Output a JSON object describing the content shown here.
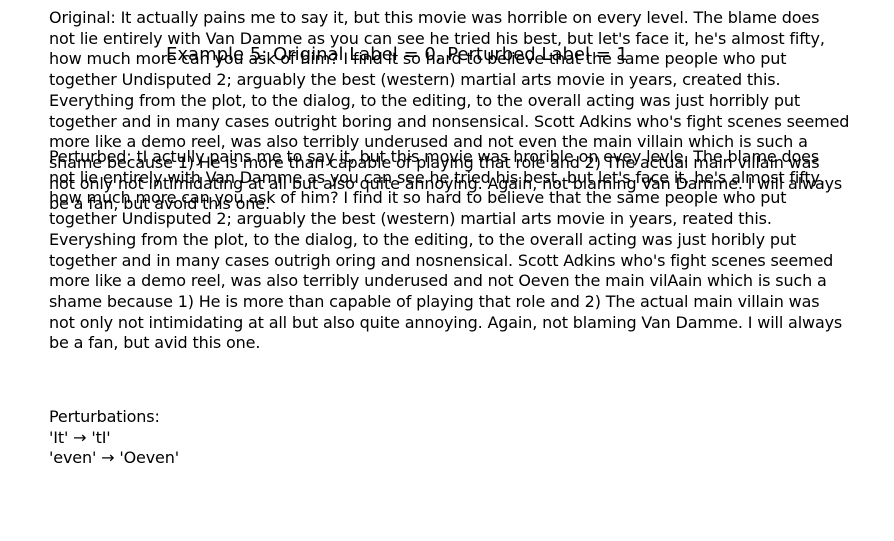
{
  "title": "Example 5: Original Label = 0, Perturbed Label = 1",
  "original_text": "Original: It actually pains me to say it, but this movie was horrible on every level. The blame does\nnot lie entirely with Van Damme as you can see he tried his best, but let's face it, he's almost fifty,\nhow much more can you ask of him? I find it so hard to believe that the same people who put\ntogether Undisputed 2; arguably the best (western) martial arts movie in years, created this.\nEverything from the plot, to the dialog, to the editing, to the overall acting was just horribly put\ntogether and in many cases outright boring and nonsensical. Scott Adkins who's fight scenes seemed\nmore like a demo reel, was also terribly underused and not even the main villain which is such a\nshame because 1) He is more than capable of playing that role and 2) The actual main villain was\nnot only not intimidating at all but also quite annoying. Again, not blaming Van Damme. I will always\nbe a fan, but avoid this one.",
  "perturbed_text": "Perturbed: tI actully pains me to say it, but this movie was hrorible on evey levle. The blame does\nnot lie entirely with Van Damme as you can see he tried his best, but let's face it, he's almost fifty,\nhow much more can you ask of him? I find it so hard to believe that the same people who put\ntogether Undisputed 2; arguably the best (western) martial arts movie in years, reated this.\nEveryshing from the plot, to the dialog, to the editing, to the overall acting was just horibly put\ntogether and in many cases outrigh oring and nosnensical. Scott Adkins who's fight scenes seemed\nmore like a demo reel, was also terribly underused and not Oeven the main vilAain which is such a\nshame because 1) He is more than capable of playing that role and 2) The actual main villain was\nnot only not intimidating at all but also quite annoying. Again, not blaming Van Damme. I will always\nbe a fan, but avid this one.",
  "perturbations_text": "Perturbations:\n'It' → 'tI'\n'even' → 'Oeven'"
}
